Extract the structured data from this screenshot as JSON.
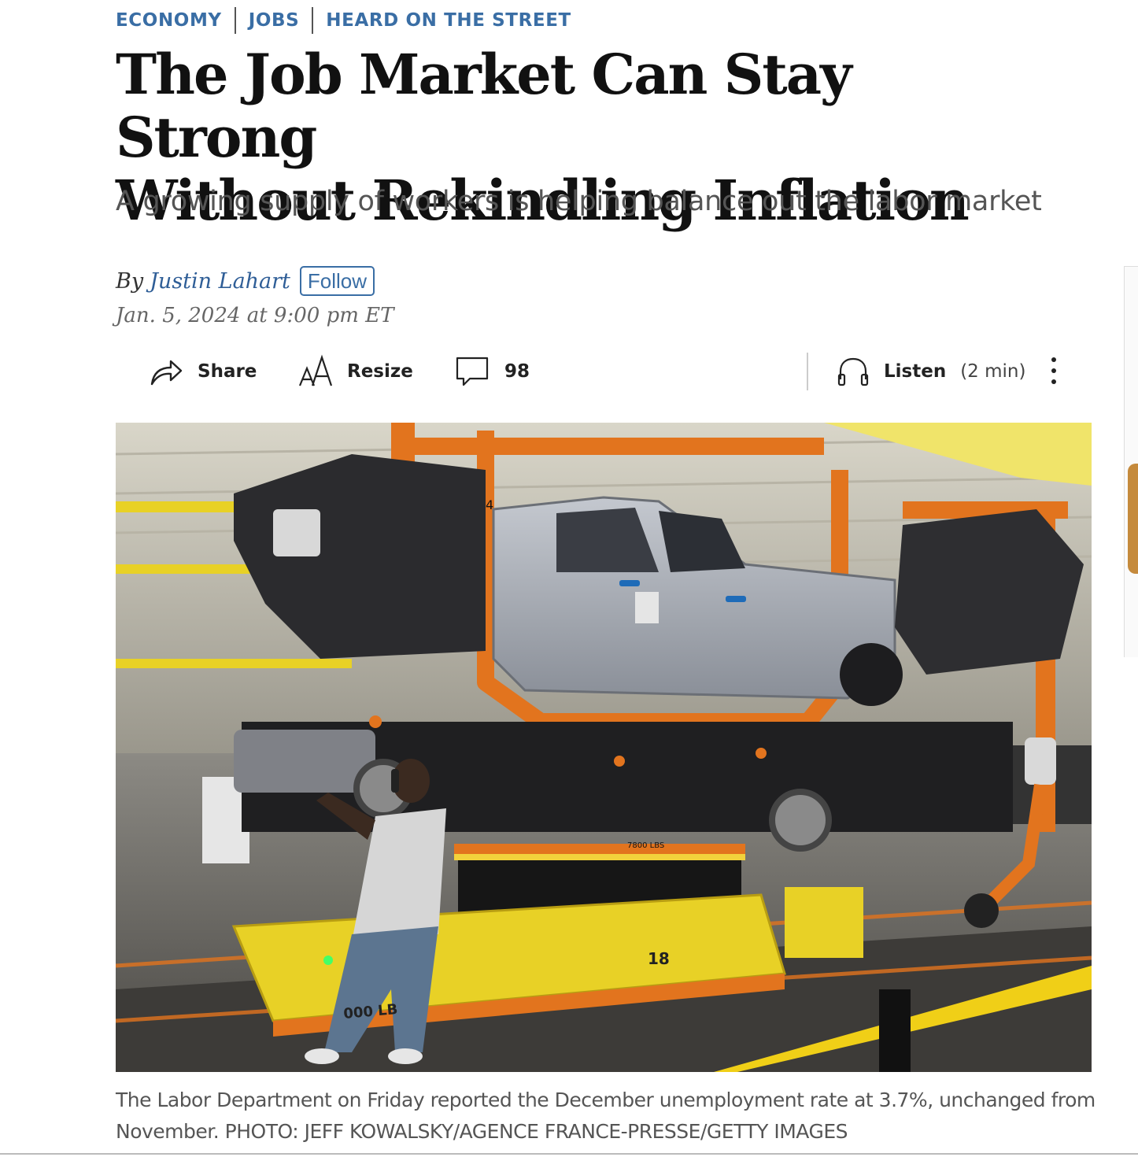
{
  "breadcrumb": [
    "ECONOMY",
    "JOBS",
    "HEARD ON THE STREET"
  ],
  "headline": {
    "line1": "The Job Market Can Stay Strong",
    "line2": "Without Rekindling Inflation"
  },
  "dek": "A growing supply of workers is helping balance out the labor market",
  "byline": {
    "prefix": "By",
    "author": "Justin Lahart",
    "follow_label": "Follow"
  },
  "dateline": "Jan. 5, 2024 at 9:00 pm ET",
  "toolbar": {
    "share_label": "Share",
    "share_icon": "share-arrow-icon",
    "resize_label": "Resize",
    "resize_icon": "text-size-icon",
    "comments_count": "98",
    "comments_icon": "comment-bubble-icon",
    "listen_label": "Listen",
    "listen_duration": "(2 min)",
    "listen_icon": "headphones-icon",
    "more_icon": "vertical-ellipsis-icon"
  },
  "photo": {
    "overlay_text": {
      "frame_number": "4",
      "cart_number": "18",
      "capacity_label": "7800 LBS",
      "cart_text": "000 LB"
    }
  },
  "caption": {
    "text": "The Labor Department on Friday reported the December unemployment rate at 3.7%, unchanged from November.",
    "credit": "PHOTO: JEFF KOWALSKY/AGENCE FRANCE-PRESSE/GETTY IMAGES"
  },
  "colors": {
    "accent": "#3a6ea5",
    "headline": "#111111",
    "frame_orange": "#e2741e",
    "cart_yellow": "#e8d126",
    "truck_gray": "#a9adb5"
  }
}
